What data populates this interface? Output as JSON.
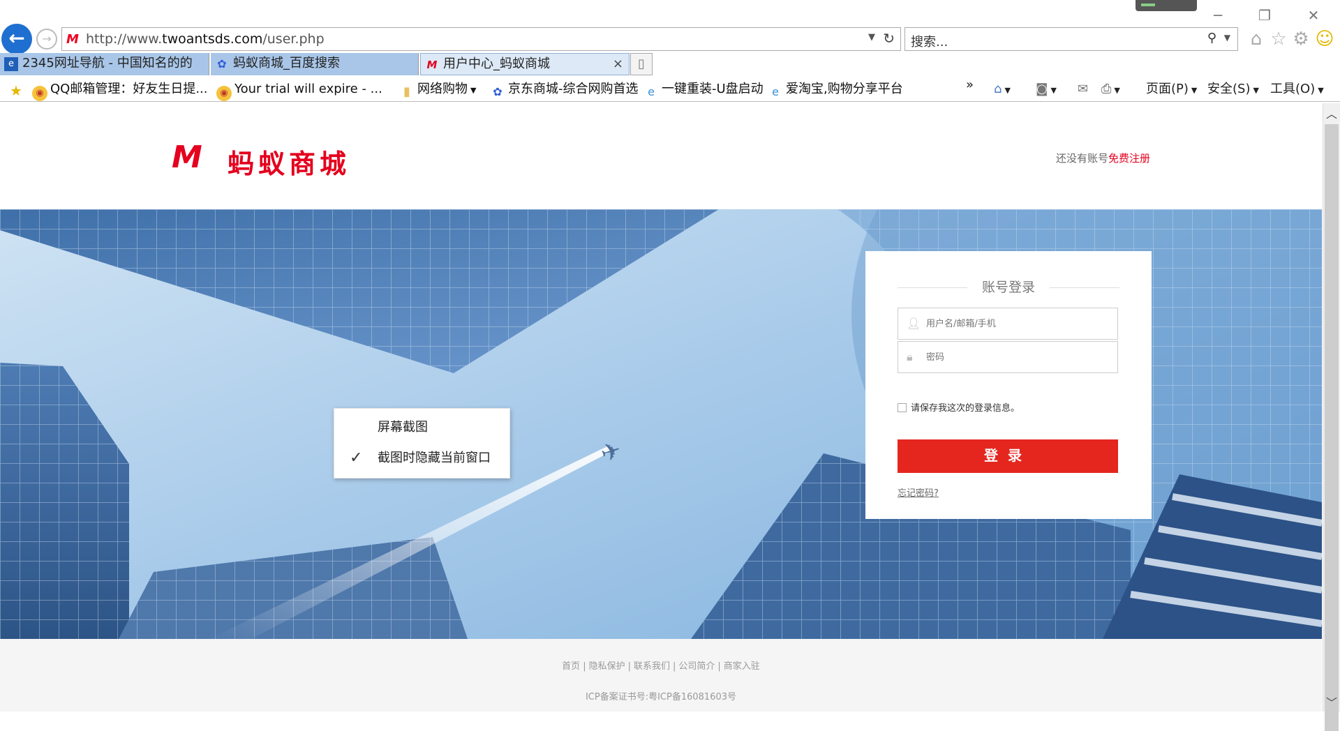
{
  "browser": {
    "address_url_prefix": "http://www.",
    "address_url_domain": "twoantsds.com",
    "address_url_path": "/user.php",
    "search_placeholder": "搜索...",
    "tabs": [
      {
        "label": "2345网址导航 - 中国知名的的"
      },
      {
        "label": "蚂蚁商城_百度搜索"
      },
      {
        "label": "用户中心_蚂蚁商城"
      }
    ],
    "favorites": [
      {
        "label": "QQ邮箱管理：好友生日提..."
      },
      {
        "label": "Your trial will expire - ..."
      },
      {
        "label": "网络购物"
      },
      {
        "label": "京东商城-综合网购首选"
      },
      {
        "label": "一键重装-U盘启动"
      },
      {
        "label": "爱淘宝,购物分享平台"
      }
    ],
    "overflow_chevron": "»",
    "commands": {
      "page": "页面(P)",
      "safety": "安全(S)",
      "tools": "工具(O)"
    }
  },
  "site": {
    "logo_text": "蚂蚁商城",
    "register_prompt": "还没有账号",
    "register_link": "免费注册"
  },
  "login": {
    "title": "账号登录",
    "username_placeholder": "用户名/邮箱/手机",
    "password_placeholder": "密码",
    "remember_label": "请保存我这次的登录信息。",
    "submit_label": "登录",
    "forgot_label": "忘记密码?"
  },
  "context_menu": {
    "items": [
      {
        "label": "屏幕截图",
        "checked": false
      },
      {
        "label": "截图时隐藏当前窗口",
        "checked": true
      }
    ]
  },
  "footer": {
    "links": [
      "首页",
      "隐私保护",
      "联系我们",
      "公司简介",
      "商家入驻"
    ],
    "icp": "ICP备案证书号:粤ICP备16081603号"
  },
  "colors": {
    "brand_red": "#e4001e",
    "button_red": "#e4261f",
    "browser_blue": "#1e6fd0"
  }
}
